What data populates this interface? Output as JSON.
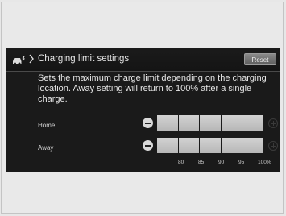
{
  "header": {
    "title": "Charging limit settings",
    "reset_label": "Reset"
  },
  "description": "Sets the maximum charge limit depending on the charging location. Away setting will return to 100% after a single charge.",
  "rows": [
    {
      "label": "Home",
      "segments_filled": 6
    },
    {
      "label": "Away",
      "segments_filled": 6
    }
  ],
  "scale_labels": [
    "80",
    "85",
    "90",
    "95",
    "100%"
  ],
  "icons": [
    "car-charging-icon",
    "chevron-right-icon",
    "minus-icon",
    "plus-icon"
  ]
}
